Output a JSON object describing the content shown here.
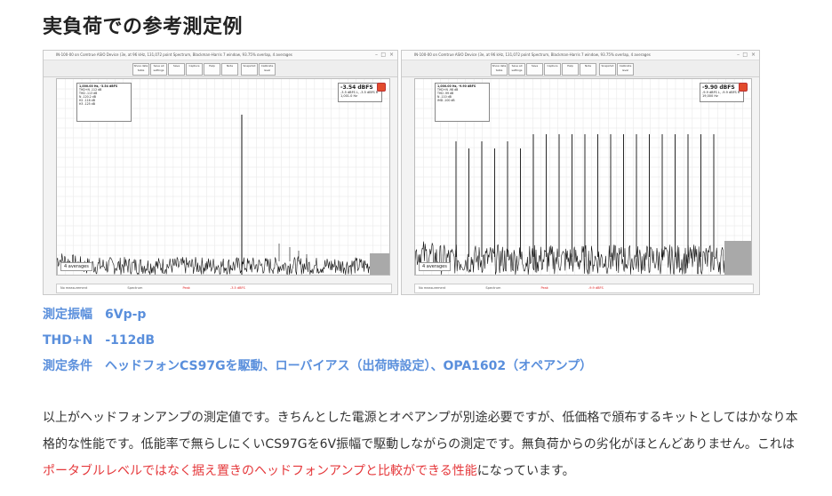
{
  "heading": "実負荷での参考測定例",
  "screenshots": {
    "left": {
      "title": "IN-100-00 on Comtrue ASIO Device (3e, at 96 kHz, 131,072 point Spectrum, Blackman-Harris 7 window, 93.75% overlap, 4 averages",
      "toolbar_buttons": [
        "Show data table",
        "Save all settings",
        "Save",
        "Capture",
        "Help",
        "Note",
        "Snapshot",
        "Calibrate level"
      ],
      "readout_value": "-3.54 dBFS",
      "readout_lines": [
        "-3.5 dBFS L, -3.5 dBFS R",
        "Peak amplitude -3.5 dBFS",
        "1,001.0 Hz"
      ],
      "stats_header": "1,000.00 Hz, -3.54 dBFS",
      "stats_lines": [
        "THD+N -112 dB",
        "THD -113 dB",
        "N -120.2 dB",
        "H2 -116 dB",
        "H3 -125 dB"
      ],
      "averages": "4 averages",
      "legend": [
        "No measurement",
        "Spectrum",
        "Peak",
        "-3.5 dBFS"
      ]
    },
    "right": {
      "title": "IN-100-00 on Comtrue ASIO Device (3e, at 96 kHz, 131,072 point Spectrum, Blackman-Harris 7 window, 93.75% overlap, 4 averages",
      "toolbar_buttons": [
        "Show data table",
        "Save all settings",
        "Save",
        "Capture",
        "Help",
        "Note",
        "Snapshot",
        "Calibrate level"
      ],
      "readout_value": "-9.90 dBFS",
      "readout_lines": [
        "-9.9 dBFS L, -9.9 dBFS R",
        "Peak amplitude -9.9 dBFS",
        "19,000 Hz"
      ],
      "stats_header": "1,000.00 Hz, -9.90 dBFS",
      "stats_lines": [
        "THD+N -98 dB",
        "THD -99 dB",
        "N -110 dB",
        "IMD -100 dB"
      ],
      "averages": "4 averages",
      "legend": [
        "No measurement",
        "Spectrum",
        "Peak",
        "-9.9 dBFS"
      ]
    }
  },
  "specs": [
    "測定振幅　6Vp-p",
    "THD+N　-112dB",
    "測定条件　ヘッドフォンCS97Gを駆動、ローバイアス（出荷時設定）、OPA1602（オペアンプ）"
  ],
  "paragraph": {
    "part1": "以上がヘッドフォンアンプの測定値です。きちんとした電源とオペアンプが別途必要ですが、低価格で頒布するキットとしてはかなり本格的な性能です。低能率で無らしにくいCS97Gを6V振幅で駆動しながらの測定です。無負荷からの劣化がほとんどありません。これは",
    "highlight": "ポータブルレベルではなく据え置きのヘッドフォンアンプと比較ができる性能",
    "part2": "になっています。"
  },
  "colors": {
    "heading": "#222222",
    "spec_blue": "#5a8fdc",
    "highlight_red": "#e5383b",
    "trace": "#111111",
    "noise_gray": "#a9a9a9"
  }
}
